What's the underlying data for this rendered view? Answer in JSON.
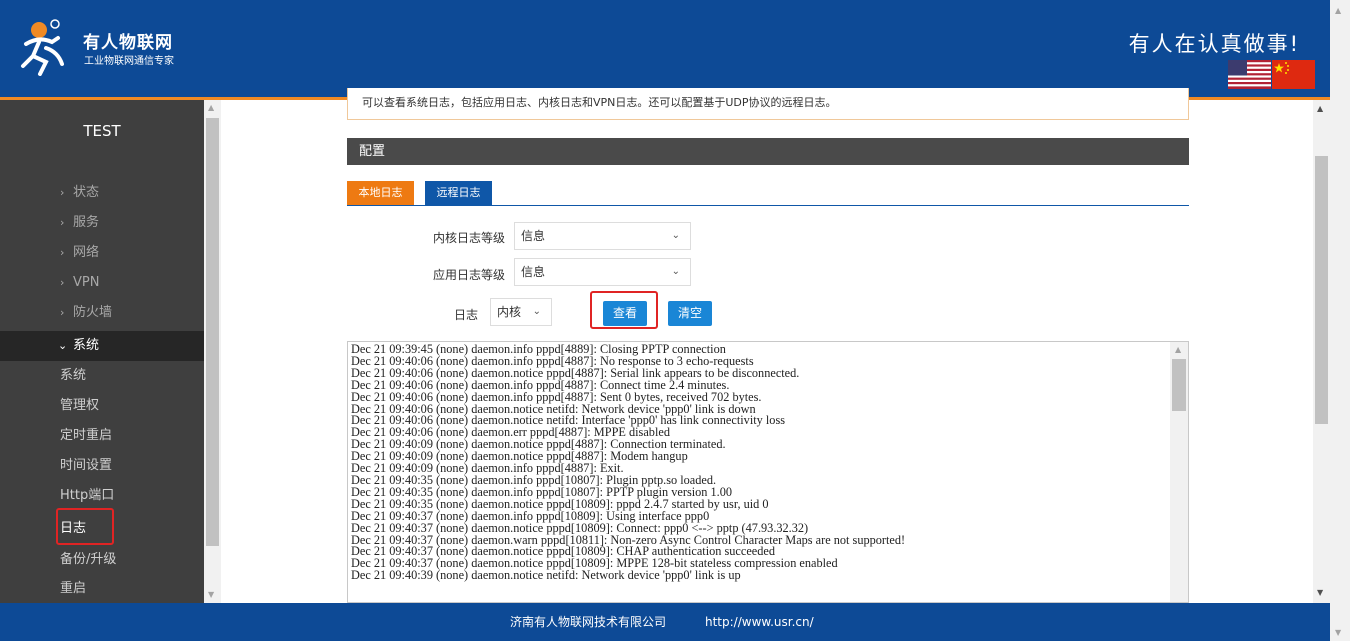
{
  "header": {
    "brand_name": "有人物联网",
    "brand_tagline": "工业物联网通信专家",
    "slogan": "有人在认真做事!",
    "icons": [
      "usr-logo-icon",
      "us-flag-icon",
      "cn-flag-icon"
    ]
  },
  "sidebar": {
    "device_name": "TEST",
    "nav_items": [
      {
        "label": "状态"
      },
      {
        "label": "服务"
      },
      {
        "label": "网络"
      },
      {
        "label": "VPN"
      },
      {
        "label": "防火墙"
      },
      {
        "label": "系统"
      }
    ],
    "sub_items": [
      {
        "label": "系统"
      },
      {
        "label": "管理权"
      },
      {
        "label": "定时重启"
      },
      {
        "label": "时间设置"
      },
      {
        "label": "Http端口"
      },
      {
        "label": "日志"
      },
      {
        "label": "备份/升级"
      },
      {
        "label": "重启"
      }
    ]
  },
  "main": {
    "description": "可以查看系统日志，包括应用日志、内核日志和VPN日志。还可以配置基于UDP协议的远程日志。",
    "section_title": "配置",
    "tabs": [
      {
        "label": "本地日志"
      },
      {
        "label": "远程日志"
      }
    ],
    "kernel_log_level": {
      "label": "内核日志等级",
      "value": "信息"
    },
    "app_log_level": {
      "label": "应用日志等级",
      "value": "信息"
    },
    "log_type": {
      "label": "日志",
      "value": "内核"
    },
    "view_button": "查看",
    "clear_button": "清空",
    "log_lines": [
      "Dec 21 09:39:45 (none) daemon.info pppd[4889]: Closing PPTP connection",
      "Dec 21 09:40:06 (none) daemon.info pppd[4887]: No response to 3 echo-requests",
      "Dec 21 09:40:06 (none) daemon.notice pppd[4887]: Serial link appears to be disconnected.",
      "Dec 21 09:40:06 (none) daemon.info pppd[4887]: Connect time 2.4 minutes.",
      "Dec 21 09:40:06 (none) daemon.info pppd[4887]: Sent 0 bytes, received 702 bytes.",
      "Dec 21 09:40:06 (none) daemon.notice netifd: Network device 'ppp0' link is down",
      "Dec 21 09:40:06 (none) daemon.notice netifd: Interface 'ppp0' has link connectivity loss",
      "Dec 21 09:40:06 (none) daemon.err pppd[4887]: MPPE disabled",
      "Dec 21 09:40:09 (none) daemon.notice pppd[4887]: Connection terminated.",
      "Dec 21 09:40:09 (none) daemon.notice pppd[4887]: Modem hangup",
      "Dec 21 09:40:09 (none) daemon.info pppd[4887]: Exit.",
      "Dec 21 09:40:35 (none) daemon.info pppd[10807]: Plugin pptp.so loaded.",
      "Dec 21 09:40:35 (none) daemon.info pppd[10807]: PPTP plugin version 1.00",
      "Dec 21 09:40:35 (none) daemon.notice pppd[10809]: pppd 2.4.7 started by usr, uid 0",
      "Dec 21 09:40:37 (none) daemon.info pppd[10809]: Using interface ppp0",
      "Dec 21 09:40:37 (none) daemon.notice pppd[10809]: Connect: ppp0 <--> pptp (47.93.32.32)",
      "Dec 21 09:40:37 (none) daemon.warn pppd[10811]: Non-zero Async Control Character Maps are not supported!",
      "Dec 21 09:40:37 (none) daemon.notice pppd[10809]: CHAP authentication succeeded",
      "Dec 21 09:40:37 (none) daemon.notice pppd[10809]: MPPE 128-bit stateless compression enabled",
      "Dec 21 09:40:39 (none) daemon.notice netifd: Network device 'ppp0' link is up"
    ]
  },
  "footer": {
    "company": "济南有人物联网技术有限公司",
    "url": "http://www.usr.cn/"
  }
}
